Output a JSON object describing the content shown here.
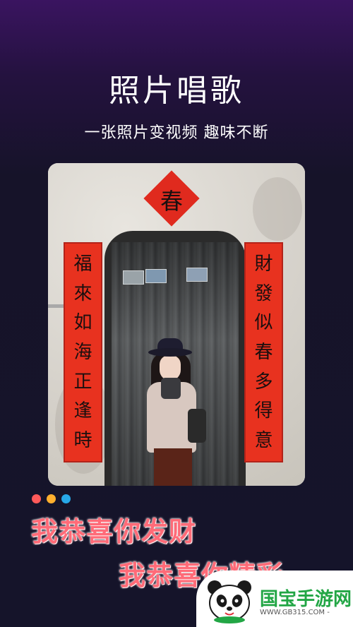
{
  "header": {
    "title": "照片唱歌",
    "subtitle": "一张照片变视频 趣味不断"
  },
  "photo": {
    "diamond_char": "春",
    "couplet_left": [
      "福",
      "來",
      "如",
      "海",
      "正",
      "逢",
      "時"
    ],
    "couplet_right": [
      "財",
      "發",
      "似",
      "春",
      "多",
      "得",
      "意"
    ]
  },
  "dots": {
    "colors": [
      "#ff5a5a",
      "#ffb02e",
      "#27a8e8"
    ]
  },
  "lyrics": {
    "line1": "我恭喜你发财",
    "line2": "我恭喜你精彩"
  },
  "watermark": {
    "name": "国宝手游网",
    "url": "WWW.GB315.COM -"
  },
  "colors": {
    "lyric": "#ff6b78",
    "couplet": "#e8321f",
    "brand_green": "#22a645"
  }
}
